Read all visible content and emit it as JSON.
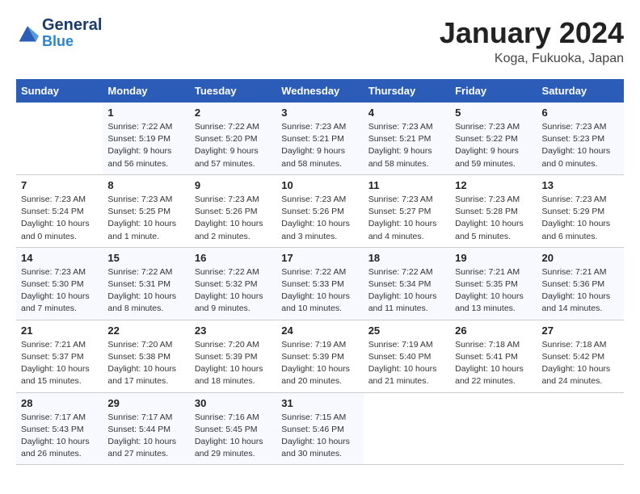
{
  "header": {
    "logo_general": "General",
    "logo_blue": "Blue",
    "title": "January 2024",
    "location": "Koga, Fukuoka, Japan"
  },
  "weekdays": [
    "Sunday",
    "Monday",
    "Tuesday",
    "Wednesday",
    "Thursday",
    "Friday",
    "Saturday"
  ],
  "weeks": [
    [
      {
        "day": "",
        "info": ""
      },
      {
        "day": "1",
        "info": "Sunrise: 7:22 AM\nSunset: 5:19 PM\nDaylight: 9 hours\nand 56 minutes."
      },
      {
        "day": "2",
        "info": "Sunrise: 7:22 AM\nSunset: 5:20 PM\nDaylight: 9 hours\nand 57 minutes."
      },
      {
        "day": "3",
        "info": "Sunrise: 7:23 AM\nSunset: 5:21 PM\nDaylight: 9 hours\nand 58 minutes."
      },
      {
        "day": "4",
        "info": "Sunrise: 7:23 AM\nSunset: 5:21 PM\nDaylight: 9 hours\nand 58 minutes."
      },
      {
        "day": "5",
        "info": "Sunrise: 7:23 AM\nSunset: 5:22 PM\nDaylight: 9 hours\nand 59 minutes."
      },
      {
        "day": "6",
        "info": "Sunrise: 7:23 AM\nSunset: 5:23 PM\nDaylight: 10 hours\nand 0 minutes."
      }
    ],
    [
      {
        "day": "7",
        "info": "Sunrise: 7:23 AM\nSunset: 5:24 PM\nDaylight: 10 hours\nand 0 minutes."
      },
      {
        "day": "8",
        "info": "Sunrise: 7:23 AM\nSunset: 5:25 PM\nDaylight: 10 hours\nand 1 minute."
      },
      {
        "day": "9",
        "info": "Sunrise: 7:23 AM\nSunset: 5:26 PM\nDaylight: 10 hours\nand 2 minutes."
      },
      {
        "day": "10",
        "info": "Sunrise: 7:23 AM\nSunset: 5:26 PM\nDaylight: 10 hours\nand 3 minutes."
      },
      {
        "day": "11",
        "info": "Sunrise: 7:23 AM\nSunset: 5:27 PM\nDaylight: 10 hours\nand 4 minutes."
      },
      {
        "day": "12",
        "info": "Sunrise: 7:23 AM\nSunset: 5:28 PM\nDaylight: 10 hours\nand 5 minutes."
      },
      {
        "day": "13",
        "info": "Sunrise: 7:23 AM\nSunset: 5:29 PM\nDaylight: 10 hours\nand 6 minutes."
      }
    ],
    [
      {
        "day": "14",
        "info": "Sunrise: 7:23 AM\nSunset: 5:30 PM\nDaylight: 10 hours\nand 7 minutes."
      },
      {
        "day": "15",
        "info": "Sunrise: 7:22 AM\nSunset: 5:31 PM\nDaylight: 10 hours\nand 8 minutes."
      },
      {
        "day": "16",
        "info": "Sunrise: 7:22 AM\nSunset: 5:32 PM\nDaylight: 10 hours\nand 9 minutes."
      },
      {
        "day": "17",
        "info": "Sunrise: 7:22 AM\nSunset: 5:33 PM\nDaylight: 10 hours\nand 10 minutes."
      },
      {
        "day": "18",
        "info": "Sunrise: 7:22 AM\nSunset: 5:34 PM\nDaylight: 10 hours\nand 11 minutes."
      },
      {
        "day": "19",
        "info": "Sunrise: 7:21 AM\nSunset: 5:35 PM\nDaylight: 10 hours\nand 13 minutes."
      },
      {
        "day": "20",
        "info": "Sunrise: 7:21 AM\nSunset: 5:36 PM\nDaylight: 10 hours\nand 14 minutes."
      }
    ],
    [
      {
        "day": "21",
        "info": "Sunrise: 7:21 AM\nSunset: 5:37 PM\nDaylight: 10 hours\nand 15 minutes."
      },
      {
        "day": "22",
        "info": "Sunrise: 7:20 AM\nSunset: 5:38 PM\nDaylight: 10 hours\nand 17 minutes."
      },
      {
        "day": "23",
        "info": "Sunrise: 7:20 AM\nSunset: 5:39 PM\nDaylight: 10 hours\nand 18 minutes."
      },
      {
        "day": "24",
        "info": "Sunrise: 7:19 AM\nSunset: 5:39 PM\nDaylight: 10 hours\nand 20 minutes."
      },
      {
        "day": "25",
        "info": "Sunrise: 7:19 AM\nSunset: 5:40 PM\nDaylight: 10 hours\nand 21 minutes."
      },
      {
        "day": "26",
        "info": "Sunrise: 7:18 AM\nSunset: 5:41 PM\nDaylight: 10 hours\nand 22 minutes."
      },
      {
        "day": "27",
        "info": "Sunrise: 7:18 AM\nSunset: 5:42 PM\nDaylight: 10 hours\nand 24 minutes."
      }
    ],
    [
      {
        "day": "28",
        "info": "Sunrise: 7:17 AM\nSunset: 5:43 PM\nDaylight: 10 hours\nand 26 minutes."
      },
      {
        "day": "29",
        "info": "Sunrise: 7:17 AM\nSunset: 5:44 PM\nDaylight: 10 hours\nand 27 minutes."
      },
      {
        "day": "30",
        "info": "Sunrise: 7:16 AM\nSunset: 5:45 PM\nDaylight: 10 hours\nand 29 minutes."
      },
      {
        "day": "31",
        "info": "Sunrise: 7:15 AM\nSunset: 5:46 PM\nDaylight: 10 hours\nand 30 minutes."
      },
      {
        "day": "",
        "info": ""
      },
      {
        "day": "",
        "info": ""
      },
      {
        "day": "",
        "info": ""
      }
    ]
  ]
}
